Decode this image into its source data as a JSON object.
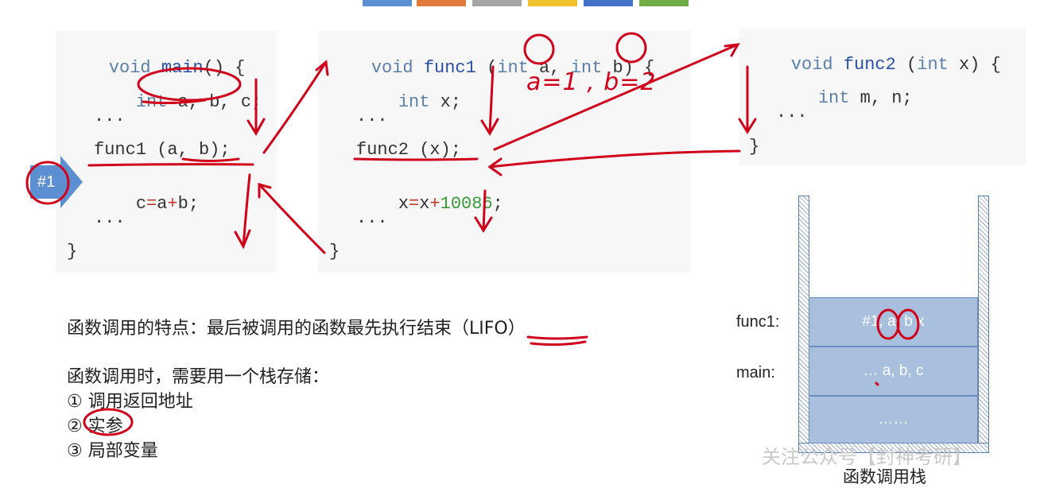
{
  "top_tabs": [
    {
      "color": "#5b8fd1"
    },
    {
      "color": "#e07b39"
    },
    {
      "color": "#a5a5a5"
    },
    {
      "color": "#f2c12e"
    },
    {
      "color": "#4472c4"
    },
    {
      "color": "#70ad47"
    }
  ],
  "main_code": {
    "l1": {
      "t1": "void",
      "t2": " main",
      "t3": "() {"
    },
    "l2": {
      "t1": "int",
      "t2": " a, b, c;"
    },
    "l3": "...",
    "l4": "func1 (a, b);",
    "l5": {
      "t1": "c",
      "t2": "=",
      "t3": "a",
      "t4": "+",
      "t5": "b;"
    },
    "l6": "...",
    "l7": "}"
  },
  "func1_code": {
    "l1": {
      "t1": "void",
      "t2": " func1",
      "t3": " (",
      "t4": "int",
      "t5": " a, ",
      "t6": "int",
      "t7": " b) {"
    },
    "l2": {
      "t1": "int",
      "t2": " x;"
    },
    "l3": "...",
    "l4": "func2 (x);",
    "l5": {
      "t1": "x",
      "t2": "=",
      "t3": "x",
      "t4": "+",
      "t5": "10086",
      "t6": ";"
    },
    "l6": "...",
    "l7": "}"
  },
  "func2_code": {
    "l1": {
      "t1": "void",
      "t2": " func2",
      "t3": " (",
      "t4": "int",
      "t5": " x) {"
    },
    "l2": {
      "t1": "int",
      "t2": " m, n;"
    },
    "l3": "...",
    "l4": "}"
  },
  "marker": {
    "label": "#1",
    "color": "#5b8fd1"
  },
  "annotation_handwritten": "a=1 , b=2",
  "notes": {
    "feature": "函数调用的特点：最后被调用的函数最先执行结束（LIFO）",
    "need_stack": "函数调用时，需要用一个栈存储：",
    "item1": "① 调用返回地址",
    "item2": "② 实参",
    "item3": "③ 局部变量"
  },
  "stack": {
    "title": "函数调用栈",
    "frames": [
      {
        "label": "func1:",
        "content": "#1, a, b x"
      },
      {
        "label": "main:",
        "content": "… a, b, c"
      },
      {
        "label": "",
        "content": "……"
      }
    ]
  },
  "watermark": "关注公众号【封神考研】",
  "colors": {
    "ink": "#d0021b",
    "frame_fill": "#a8c0de"
  }
}
